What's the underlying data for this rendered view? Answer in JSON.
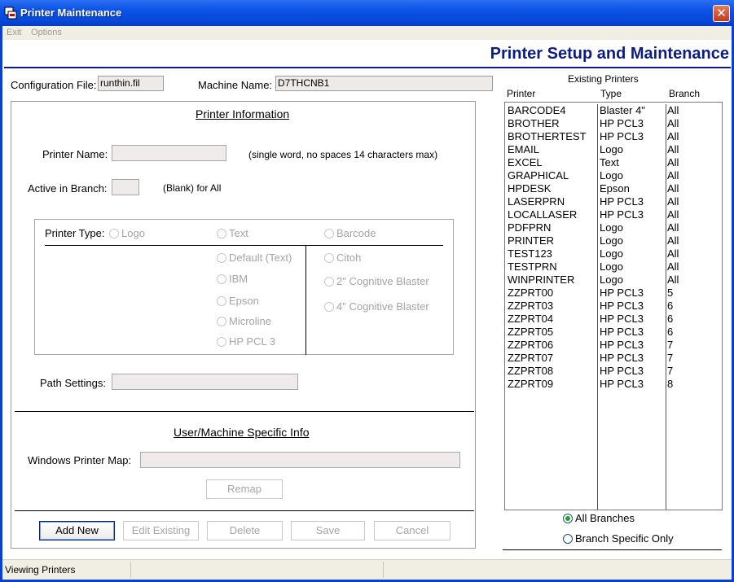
{
  "window": {
    "title": "Printer Maintenance",
    "close_glyph": "✕"
  },
  "menu": {
    "exit": "Exit",
    "options": "Options"
  },
  "header": {
    "title": "Printer Setup and Maintenance"
  },
  "config": {
    "config_file_label": "Configuration File:",
    "config_file_value": "runthin.fil",
    "machine_name_label": "Machine Name:",
    "machine_name_value": "D7THCNB1"
  },
  "printer_info": {
    "heading": "Printer Information",
    "printer_name_label": "Printer Name:",
    "printer_name_value": "",
    "printer_name_hint": "(single word, no spaces 14 characters max)",
    "active_branch_label": "Active in Branch:",
    "active_branch_value": "",
    "active_branch_hint": "(Blank) for All",
    "printer_type_label": "Printer Type:",
    "type_options": [
      "Logo",
      "Text",
      "Barcode"
    ],
    "text_options": [
      "Default (Text)",
      "IBM",
      "Epson",
      "Microline",
      "HP PCL 3"
    ],
    "barcode_options": [
      "Citoh",
      "2\" Cognitive Blaster",
      "4\" Cognitive Blaster"
    ],
    "path_settings_label": "Path Settings:",
    "path_settings_value": ""
  },
  "user_info": {
    "heading": "User/Machine Specific Info",
    "windows_map_label": "Windows Printer Map:",
    "windows_map_value": "",
    "remap_label": "Remap"
  },
  "actions": {
    "add_new": "Add New",
    "edit_existing": "Edit Existing",
    "delete": "Delete",
    "save": "Save",
    "cancel": "Cancel"
  },
  "existing_printers": {
    "heading": "Existing Printers",
    "columns": [
      "Printer",
      "Type",
      "Branch"
    ],
    "rows": [
      [
        "BARCODE4",
        "Blaster 4\"",
        "All"
      ],
      [
        "BROTHER",
        "HP PCL3",
        "All"
      ],
      [
        "BROTHERTEST",
        "HP PCL3",
        "All"
      ],
      [
        "EMAIL",
        "Logo",
        "All"
      ],
      [
        "EXCEL",
        "Text",
        "All"
      ],
      [
        "GRAPHICAL",
        "Logo",
        "All"
      ],
      [
        "HPDESK",
        "Epson",
        "All"
      ],
      [
        "LASERPRN",
        "HP PCL3",
        "All"
      ],
      [
        "LOCALLASER",
        "HP PCL3",
        "All"
      ],
      [
        "PDFPRN",
        "Logo",
        "All"
      ],
      [
        "PRINTER",
        "Logo",
        "All"
      ],
      [
        "TEST123",
        "Logo",
        "All"
      ],
      [
        "TESTPRN",
        "Logo",
        "All"
      ],
      [
        "WINPRINTER",
        "Logo",
        "All"
      ],
      [
        "ZZPRT00",
        "HP PCL3",
        "5"
      ],
      [
        "ZZPRT03",
        "HP PCL3",
        "6"
      ],
      [
        "ZZPRT04",
        "HP PCL3",
        "6"
      ],
      [
        "ZZPRT05",
        "HP PCL3",
        "6"
      ],
      [
        "ZZPRT06",
        "HP PCL3",
        "7"
      ],
      [
        "ZZPRT07",
        "HP PCL3",
        "7"
      ],
      [
        "ZZPRT08",
        "HP PCL3",
        "7"
      ],
      [
        "ZZPRT09",
        "HP PCL3",
        "8"
      ]
    ],
    "filter_all": "All Branches",
    "filter_branch": "Branch Specific Only",
    "selected_filter": "all"
  },
  "status": {
    "text": "Viewing Printers"
  },
  "colors": {
    "accent": "#0b1d82",
    "titlebar": "#0a52e6",
    "radio_checked": "#21a121"
  }
}
